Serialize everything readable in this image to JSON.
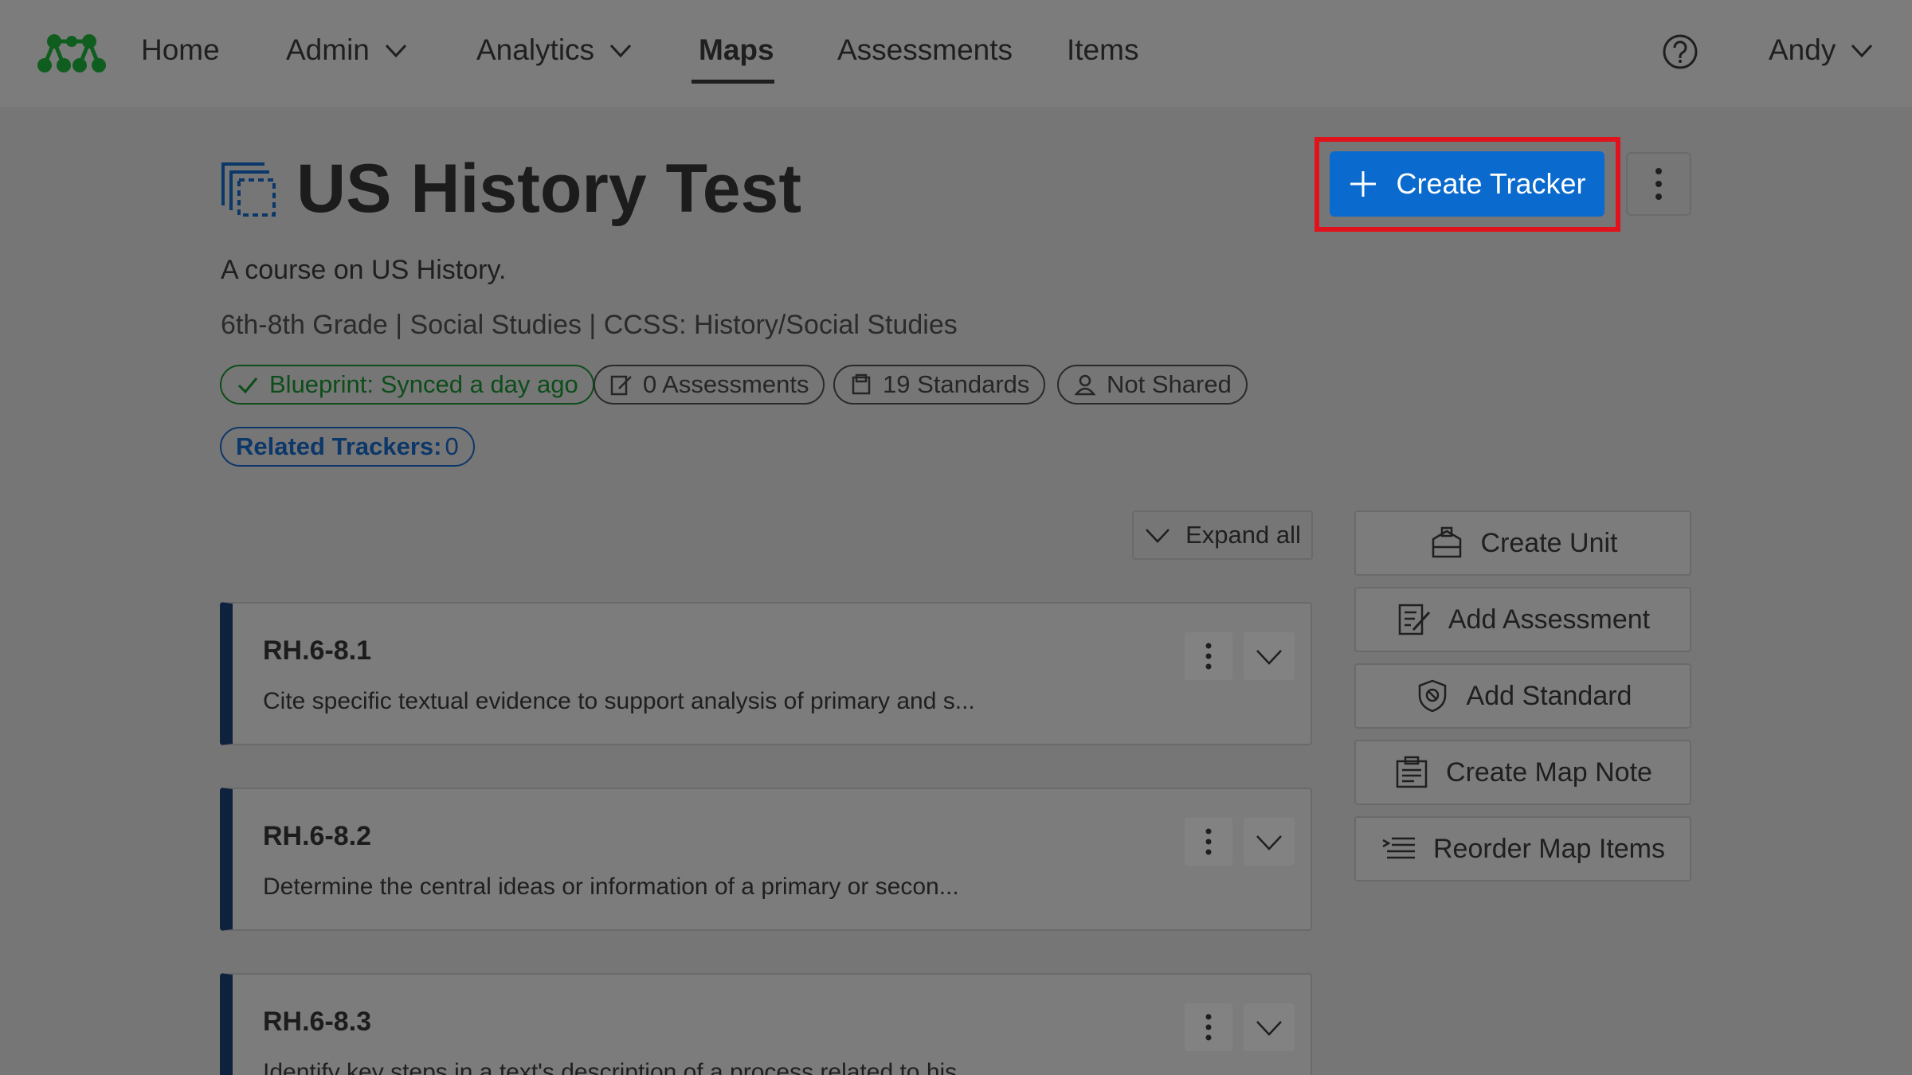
{
  "nav": {
    "items": [
      {
        "label": "Home"
      },
      {
        "label": "Admin"
      },
      {
        "label": "Analytics"
      },
      {
        "label": "Maps"
      },
      {
        "label": "Assessments"
      },
      {
        "label": "Items"
      }
    ],
    "active": "Maps",
    "user": "Andy"
  },
  "header": {
    "title": "US History Test",
    "description": "A course on US History.",
    "meta": "6th-8th Grade | Social Studies | CCSS: History/Social Studies",
    "create_tracker_label": "Create Tracker"
  },
  "badges": {
    "blueprint": "Blueprint: Synced a day ago",
    "assessments": "0 Assessments",
    "standards": "19 Standards",
    "sharing": "Not Shared",
    "related_label": "Related Trackers:",
    "related_count": "0"
  },
  "expand_all_label": "Expand all",
  "standards": [
    {
      "code": "RH.6-8.1",
      "description": "Cite specific textual evidence to support analysis of primary and s..."
    },
    {
      "code": "RH.6-8.2",
      "description": "Determine the central ideas or information of a primary or secon..."
    },
    {
      "code": "RH.6-8.3",
      "description": "Identify key steps in a text's description of a process related to his..."
    }
  ],
  "actions": {
    "create_unit": "Create Unit",
    "add_assessment": "Add Assessment",
    "add_standard": "Add Standard",
    "create_map_note": "Create Map Note",
    "reorder_map_items": "Reorder Map Items"
  },
  "colors": {
    "primary": "#0a6acd",
    "highlight": "#e0121b",
    "synced_green": "#0c4d19",
    "related_blue": "#0c3769",
    "card_accent": "#0e213d",
    "logo_green": "#0f5e1f"
  }
}
